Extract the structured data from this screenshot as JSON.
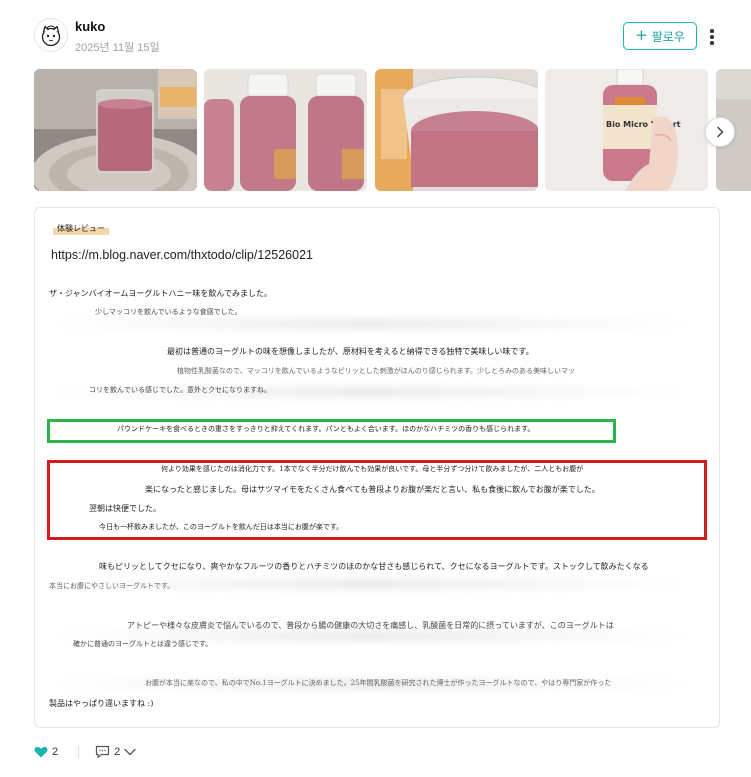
{
  "post": {
    "username": "kuko",
    "date": "2025년 11월 15일",
    "follow_label": "팔로우"
  },
  "gallery": {
    "images": [
      {
        "name": "pink-yogurt-glass-on-coaster"
      },
      {
        "name": "yogurt-bottles-row"
      },
      {
        "name": "yogurt-glass-closeup"
      },
      {
        "name": "hand-holding-yogurt-bottle"
      }
    ],
    "bottle_label": "Bio Micro Yogurt"
  },
  "content": {
    "tag": "体験レビュー",
    "link": "https://m.blog.naver.com/thxtodo/clip/12526021",
    "lines": {
      "l1": "ザ・ジャンバイオームヨーグルトハニー味を飲んでみました。",
      "l2": "少しマッコリを飲んでいるような食感でした。",
      "l3": "最初は普通のヨーグルトの味を想像しましたが、原材料を考えると納得できる独特で美味しい味です。",
      "l4": "植物性乳酸菌なので、マッコリを飲んでいるようなピリッとした刺激がほんのり感じられます。少しとろみのある美味しいマッ",
      "l5": "コリを飲んでいる感じでした。意外とクセになりますね。",
      "l6": "パウンドケーキを食べるときの重さをすっきりと抑えてくれます。パンともよく合います。ほのかなハチミツの香りも感じられます。",
      "l7": "何より効果を感じたのは消化力です。1本でなく半分だけ飲んでも効果が良いです。母と半分ずつ分けて飲みましたが、二人ともお腹が",
      "l8": "楽になったと感じました。母はサツマイモをたくさん食べても普段よりお腹が楽だと言い、私も食後に飲んでお腹が楽でした。",
      "l9": "翌朝は快便でした。",
      "l10": "今日も一杯飲みましたが、このヨーグルトを飲んだ日は本当にお腹が楽です。",
      "l11": "味もピリッとしてクセになり、爽やかなフルーツの香りとハチミツのほのかな甘さも感じられて、クセになるヨーグルトです。ストックして飲みたくなる",
      "l12": "本当にお腹にやさしいヨーグルトです。",
      "l13": "アトピーや様々な皮膚炎で悩んでいるので、普段から腸の健康の大切さを痛感し、乳酸菌を日常的に摂っていますが、このヨーグルトは",
      "l14": "確かに普通のヨーグルトとは違う感じです。",
      "l15": "お腹が本当に楽なので、私の中でNo.1ヨーグルトに決めました。25年間乳酸菌を研究された博士が作ったヨーグルトなので、やはり専門家が作った",
      "l16": "製品はやっぱり違いますね :)"
    }
  },
  "footer": {
    "likes_count": "2",
    "comments_count": "2"
  },
  "colors": {
    "accent": "#19b3b3",
    "highlight_green": "#2fb44a",
    "highlight_red": "#d41c1c"
  }
}
